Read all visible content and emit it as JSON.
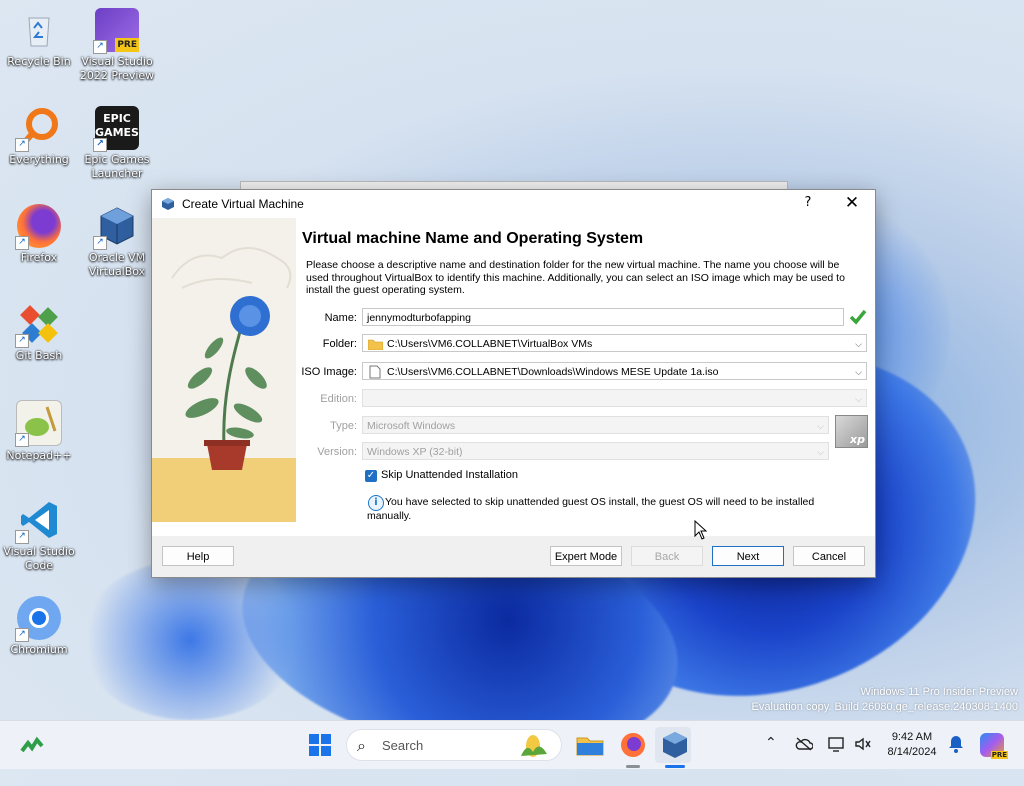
{
  "desktop": {
    "icons": [
      {
        "label": "Recycle Bin"
      },
      {
        "label": "Visual Studio 2022 Preview",
        "badge": "PRE"
      },
      {
        "label": "Everything"
      },
      {
        "label": "Epic Games Launcher",
        "logo": "EPIC\nGAMES"
      },
      {
        "label": "Firefox"
      },
      {
        "label": "Oracle VM VirtualBox"
      },
      {
        "label": "Git Bash"
      },
      {
        "label": "Notepad++"
      },
      {
        "label": "Visual Studio Code"
      },
      {
        "label": "Chromium"
      }
    ],
    "watermark": {
      "line1": "Windows 11 Pro Insider Preview",
      "line2": "Evaluation copy. Build 26080.ge_release.240308-1400"
    }
  },
  "dialog": {
    "title": "Create Virtual Machine",
    "help_glyph": "?",
    "close_glyph": "✕",
    "heading": "Virtual machine Name and Operating System",
    "description": "Please choose a descriptive name and destination folder for the new virtual machine. The name you choose will be used throughout VirtualBox to identify this machine. Additionally, you can select an ISO image which may be used to install the guest operating system.",
    "fields": {
      "name": {
        "label": "Name:",
        "value": "jennymodturbofapping"
      },
      "folder": {
        "label": "Folder:",
        "value": "C:\\Users\\VM6.COLLABNET\\VirtualBox VMs"
      },
      "iso": {
        "label": "ISO Image:",
        "value": "C:\\Users\\VM6.COLLABNET\\Downloads\\Windows MESE Update 1a.iso"
      },
      "edition": {
        "label": "Edition:",
        "value": ""
      },
      "type": {
        "label": "Type:",
        "value": "Microsoft Windows"
      },
      "version": {
        "label": "Version:",
        "value": "Windows XP (32-bit)"
      }
    },
    "os_badge": "xp",
    "skip_unattended": {
      "label": "Skip Unattended Installation",
      "checked": true
    },
    "info_text": "You have selected to skip unattended guest OS install, the guest OS will need to be installed manually.",
    "buttons": {
      "help": "Help",
      "expert": "Expert Mode",
      "back": "Back",
      "next": "Next",
      "cancel": "Cancel"
    }
  },
  "taskbar": {
    "search_placeholder": "Search",
    "clock_time": "9:42 AM",
    "clock_date": "8/14/2024",
    "copilot_badge": "PRE"
  },
  "colors": {
    "accent": "#1e6fc5",
    "taskbar_bg": "#eef2f8",
    "dialog_bg": "#f0f0f0"
  }
}
